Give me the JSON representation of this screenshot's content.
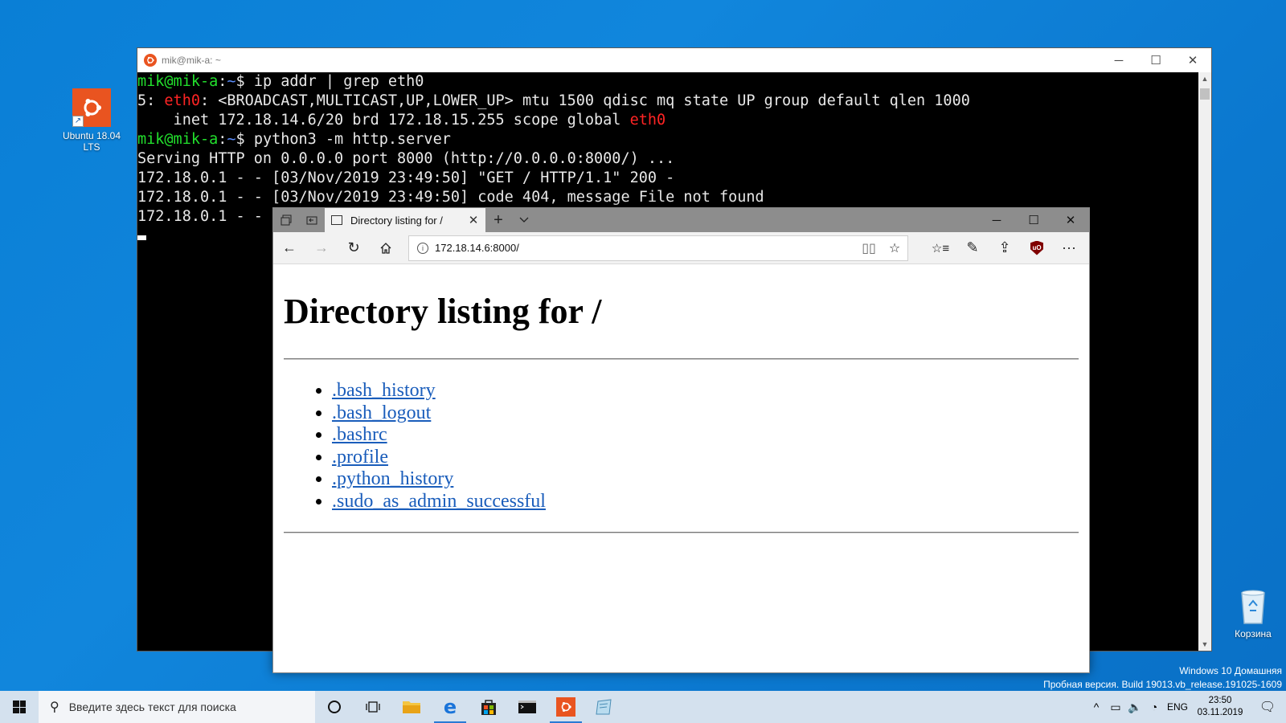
{
  "desktop": {
    "icons": [
      {
        "label": "Ubuntu 18.04 LTS"
      },
      {
        "label": "Корзина"
      }
    ],
    "watermark": {
      "line1": "Windows 10 Домашняя",
      "line2": "Пробная версия. Build 19013.vb_release.191025-1609"
    }
  },
  "terminal": {
    "title": "mik@mik-a: ~",
    "prompt_user": "mik@mik-a",
    "prompt_colon": ":",
    "prompt_path": "~",
    "prompt_dollar": "$ ",
    "cmd1": "ip addr | grep eth0",
    "out1_pre": "5: ",
    "out1_iface": "eth0",
    "out1_post": ": <BROADCAST,MULTICAST,UP,LOWER_UP> mtu 1500 qdisc mq state UP group default qlen 1000",
    "out2_pre": "    inet 172.18.14.6/20 brd 172.18.15.255 scope global ",
    "out2_iface": "eth0",
    "cmd2": "python3 -m http.server",
    "out3": "Serving HTTP on 0.0.0.0 port 8000 (http://0.0.0.0:8000/) ...",
    "out4": "172.18.0.1 - - [03/Nov/2019 23:49:50] \"GET / HTTP/1.1\" 200 -",
    "out5": "172.18.0.1 - - [03/Nov/2019 23:49:50] code 404, message File not found",
    "out6": "172.18.0.1 - - "
  },
  "browser": {
    "tab_title": "Directory listing for /",
    "url": "172.18.14.6:8000/",
    "heading": "Directory listing for /",
    "files": [
      ".bash_history",
      ".bash_logout",
      ".bashrc",
      ".profile",
      ".python_history",
      ".sudo_as_admin_successful"
    ]
  },
  "taskbar": {
    "search_placeholder": "Введите здесь текст для поиска",
    "lang": "ENG",
    "time": "23:50",
    "date": "03.11.2019"
  },
  "colors": {
    "desktop_bg": "#0b78cf",
    "ubuntu_orange": "#e95420",
    "terminal_green": "#22e02d",
    "terminal_blue": "#5c8fff",
    "terminal_red": "#ff2424",
    "link_blue": "#1a5dbb"
  }
}
